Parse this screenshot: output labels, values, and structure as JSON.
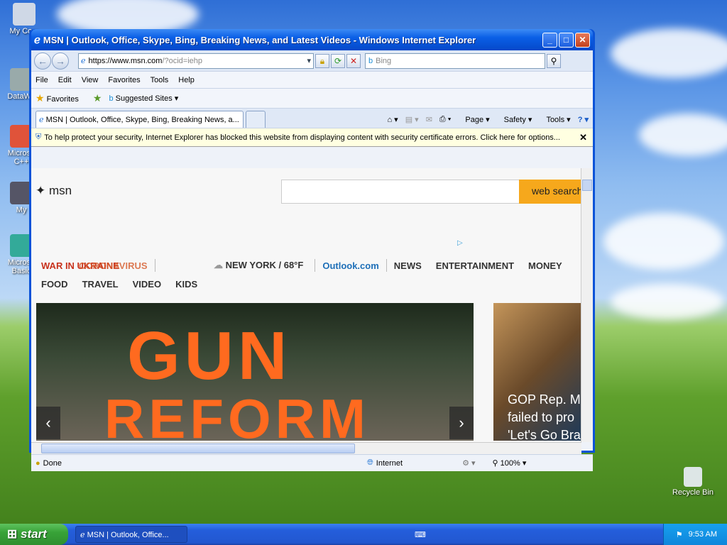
{
  "desktop": {
    "icons": [
      "My Com",
      "DataWa",
      "Microso C++",
      "My",
      "Microso Basic"
    ],
    "recycle_bin": "Recycle Bin"
  },
  "window": {
    "title": "MSN | Outlook, Office, Skype, Bing, Breaking News, and Latest Videos - Windows Internet Explorer"
  },
  "navbar": {
    "url_prefix": "https://www.msn.com",
    "url_rest": "/?ocid=iehp",
    "search_placeholder": "Bing"
  },
  "menu": [
    "File",
    "Edit",
    "View",
    "Favorites",
    "Tools",
    "Help"
  ],
  "favorites": {
    "label": "Favorites",
    "suggested": "Suggested Sites"
  },
  "tab": {
    "title": "MSN | Outlook, Office, Skype, Bing, Breaking News, a..."
  },
  "toolbar": {
    "page": "Page",
    "safety": "Safety",
    "tools": "Tools"
  },
  "infobar": {
    "text": "To help protect your security, Internet Explorer has blocked this website from displaying content with security certificate errors. Click here for options..."
  },
  "msn": {
    "logo": "msn",
    "search_button": "web search",
    "nav1": {
      "alert": "WAR IN UKRAINE",
      "alert2": "CORONAVIRUS",
      "weather": "NEW YORK / 68°F",
      "outlook": "Outlook.com",
      "news": "NEWS",
      "entertainment": "ENTERTAINMENT",
      "money": "MONEY"
    },
    "nav2": [
      "FOOD",
      "TRAVEL",
      "VIDEO",
      "KIDS"
    ],
    "hero_text1": "GUN",
    "hero_text2": "REFORM",
    "side_text": [
      "GOP Rep. M",
      "failed to pro",
      "'Let's Go Bra"
    ]
  },
  "status": {
    "left": "Done",
    "zone": "Internet",
    "zoom": "100%"
  },
  "taskbar": {
    "start": "start",
    "task": "MSN | Outlook, Office...",
    "time": "9:53 AM"
  }
}
